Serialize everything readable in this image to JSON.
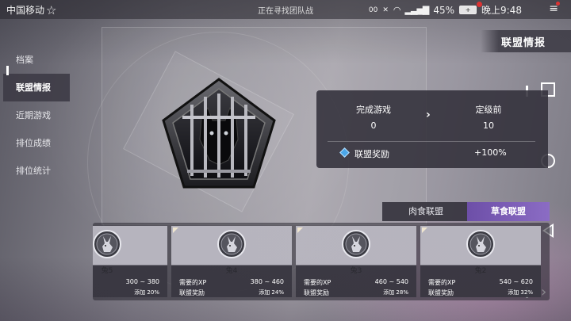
{
  "status_bar": {
    "carrier": "中国移动",
    "center_text": "正在寻找团队战",
    "data_speed": "00",
    "battery_percent": "45%",
    "time": "晚上9:48"
  },
  "page_title": "联盟情报",
  "sidebar": {
    "items": [
      {
        "label": "档案"
      },
      {
        "label": "联盟情报"
      },
      {
        "label": "近期游戏"
      },
      {
        "label": "排位成绩"
      },
      {
        "label": "排位统计"
      }
    ]
  },
  "stats": {
    "completed_games_label": "完成游戏",
    "completed_games_value": "0",
    "placement_label": "定级前",
    "placement_value": "10",
    "reward_label": "联盟奖励",
    "reward_value": "+100%"
  },
  "tabs": [
    {
      "label": "肉食联盟",
      "active": false
    },
    {
      "label": "草食联盟",
      "active": true
    }
  ],
  "cards": [
    {
      "name": "兔5",
      "xp_label": "",
      "xp": "300 ~ 380",
      "reward_label": "",
      "reward": "添加 20%"
    },
    {
      "name": "兔4",
      "xp_label": "需要的XP",
      "xp": "380 ~ 460",
      "reward_label": "联盟奖励",
      "reward": "添加 24%"
    },
    {
      "name": "兔3",
      "xp_label": "需要的XP",
      "xp": "460 ~ 540",
      "reward_label": "联盟奖励",
      "reward": "添加 28%"
    },
    {
      "name": "兔2",
      "xp_label": "需要的XP",
      "xp": "540 ~ 620",
      "reward_label": "联盟奖励",
      "reward": "添加 32%"
    }
  ],
  "colors": {
    "active_tab": "#7b5db6",
    "reward_icon": "#4aa6e8",
    "panel": "#32303a"
  }
}
